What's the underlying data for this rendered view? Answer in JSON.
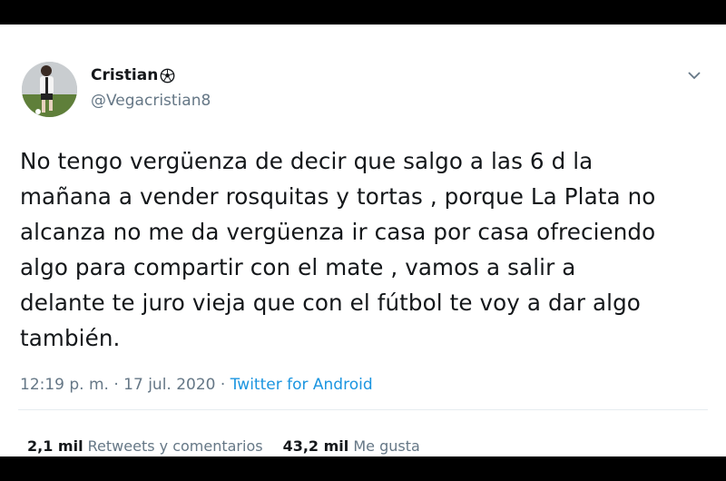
{
  "user": {
    "name": "Cristian",
    "emoji": "⚽",
    "handle": "@Vegacristian8"
  },
  "tweet": {
    "text": "No tengo vergüenza de decir que salgo a las 6 d la\nmañana a vender rosquitas y tortas , porque La Plata no\nalcanza no me da vergüenza ir casa por casa ofreciendo\nalgo para compartir con el mate , vamos a salir a\ndelante te juro vieja que con el fútbol te voy a dar algo\ntambién.",
    "timestamp": "12:19 p. m. · 17 jul. 2020 · ",
    "source": "Twitter for Android"
  },
  "stats": {
    "retweets_count": "2,1 mil",
    "retweets_label": "Retweets y comentarios",
    "likes_count": "43,2 mil",
    "likes_label": "Me gusta"
  },
  "icons": {
    "avatar": "avatar-photo",
    "menu": "chevron-down-icon"
  },
  "colors": {
    "link": "#1b95e0",
    "secondary_text": "#657786",
    "primary_text": "#14171a"
  }
}
